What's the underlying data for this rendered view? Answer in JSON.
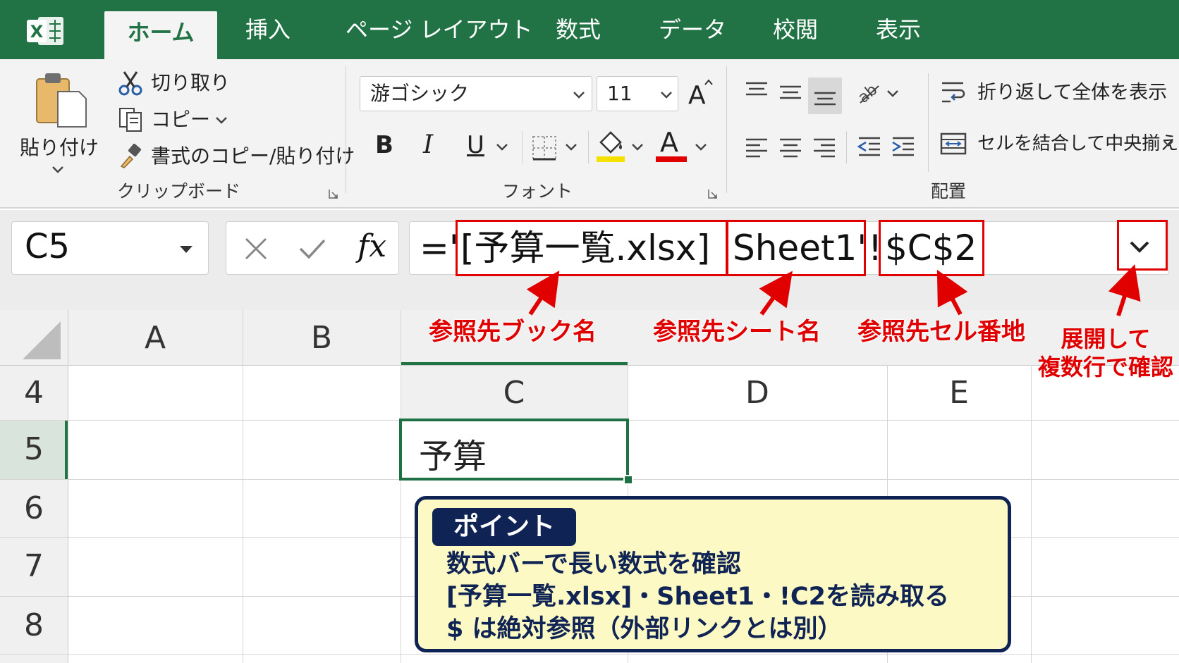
{
  "tabs": [
    {
      "label": "ホーム",
      "active": true
    },
    {
      "label": "挿入"
    },
    {
      "label": "ページ レイアウト"
    },
    {
      "label": "数式"
    },
    {
      "label": "データ"
    },
    {
      "label": "校閲"
    },
    {
      "label": "表示"
    }
  ],
  "ribbon": {
    "clipboard": {
      "paste": "貼り付け",
      "cut": "切り取り",
      "copy": "コピー",
      "format_painter": "書式のコピー/貼り付け",
      "group_label": "クリップボード"
    },
    "font": {
      "font_name": "游ゴシック",
      "font_size": "11",
      "bold": "B",
      "italic": "I",
      "underline": "U",
      "font_color_letter": "A",
      "grow_letter": "A",
      "group_label": "フォント"
    },
    "alignment": {
      "wrap_text": "折り返して全体を表示",
      "merge_center": "セルを結合して中央揃え",
      "group_label": "配置"
    }
  },
  "formula_bar": {
    "name_box": "C5",
    "fx": "fx",
    "formula_prefix": "='",
    "book_part": "[予算一覧.xlsx]",
    "sheet_part": "Sheet1'",
    "bang": "!",
    "cell_part": "$C$2"
  },
  "annotations": {
    "book": "参照先ブック名",
    "sheet": "参照先シート名",
    "cell": "参照先セル番地",
    "expand_line1": "展開して",
    "expand_line2": "複数行で確認"
  },
  "grid": {
    "col_headers_top": [
      "A",
      "B"
    ],
    "col_headers_row4": [
      "C",
      "D",
      "E"
    ],
    "row_numbers": [
      "4",
      "5",
      "6",
      "7",
      "8"
    ],
    "c5_value": "予算"
  },
  "point": {
    "badge": "ポイント",
    "line1": "数式バーで長い数式を確認",
    "line2": "[予算一覧.xlsx]・Sheet1・!C2を読み取る",
    "line3": "$ は絶対参照（外部リンクとは別）"
  },
  "colors": {
    "excel_green": "#217346",
    "annotation_red": "#e00000",
    "point_navy": "#0f2454",
    "point_bg": "#fdf9c4"
  }
}
